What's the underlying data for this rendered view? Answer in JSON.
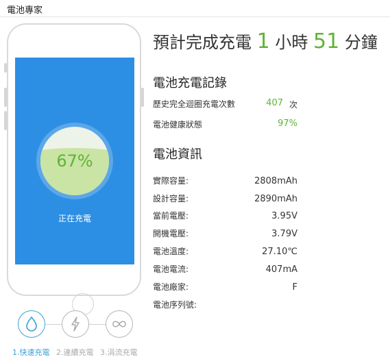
{
  "app": {
    "title": "電池專家"
  },
  "phone": {
    "battery_percent": "67%",
    "battery_level": 0.67,
    "status": "正在充電"
  },
  "estimate": {
    "prefix": "預計完成充電",
    "hours": "1",
    "hours_unit": "小時",
    "minutes": "51",
    "minutes_unit": "分鐘"
  },
  "record": {
    "title": "電池充電記錄",
    "cycles_label": "歷史完全迴圈充電次數",
    "cycles_value": "407",
    "cycles_unit": "次",
    "health_label": "電池健康狀態",
    "health_value": "97%"
  },
  "info": {
    "title": "電池資訊",
    "rows": [
      {
        "label": "實際容量:",
        "value": "2808mAh"
      },
      {
        "label": "設計容量:",
        "value": "2890mAh"
      },
      {
        "label": "當前電壓:",
        "value": "3.95V"
      },
      {
        "label": "開機電壓:",
        "value": "3.79V"
      },
      {
        "label": "電池溫度:",
        "value": "27.10℃"
      },
      {
        "label": "電池電流:",
        "value": "407mA"
      },
      {
        "label": "電池廠家:",
        "value": "F"
      },
      {
        "label": "電池序列號:",
        "value": ""
      }
    ]
  },
  "modes": [
    {
      "label": "1.快速充電",
      "icon": "droplet-icon",
      "active": true
    },
    {
      "label": "2.連續充電",
      "icon": "lightning-icon",
      "active": false
    },
    {
      "label": "3.涓流充電",
      "icon": "infinity-icon",
      "active": false
    }
  ],
  "colors": {
    "accent_green": "#5fb336",
    "screen_blue": "#2d8fe3",
    "active_mode": "#3b9fd6",
    "inactive_mode": "#aaaaaa"
  }
}
